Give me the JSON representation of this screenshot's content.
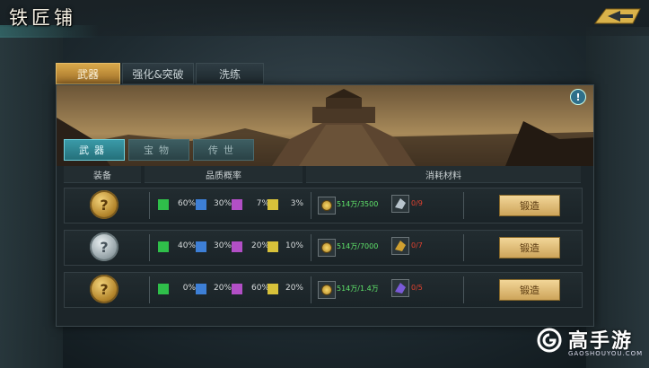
{
  "window": {
    "title": "铁匠铺"
  },
  "main_tabs": [
    {
      "label": "武器",
      "active": true
    },
    {
      "label": "强化&突破",
      "active": false
    },
    {
      "label": "洗练",
      "active": false
    }
  ],
  "sub_tabs": [
    {
      "label": "武器",
      "active": true
    },
    {
      "label": "宝物",
      "active": false
    },
    {
      "label": "传世",
      "active": false
    }
  ],
  "info_icon": {
    "glyph": "!"
  },
  "table": {
    "headers": [
      "装备",
      "品质概率",
      "消耗材料"
    ],
    "rows": [
      {
        "equip_icon": "mystery-gold-coin-icon",
        "equip_glyph": "?",
        "probabilities": [
          "60%",
          "30%",
          "7%",
          "3%"
        ],
        "coin_cost": "514万/3500",
        "material_icon": "silver-ore-icon",
        "material_count": "0/9",
        "button": "锻造"
      },
      {
        "equip_icon": "mystery-silver-coin-icon",
        "equip_glyph": "?",
        "probabilities": [
          "40%",
          "30%",
          "20%",
          "10%"
        ],
        "coin_cost": "514万/7000",
        "material_icon": "gold-ore-icon",
        "material_count": "0/7",
        "button": "锻造"
      },
      {
        "equip_icon": "mystery-gold-coin-icon",
        "equip_glyph": "?",
        "probabilities": [
          "0%",
          "20%",
          "60%",
          "20%"
        ],
        "coin_cost": "514万/1.4万",
        "material_icon": "purple-ore-icon",
        "material_count": "0/5",
        "button": "锻造"
      }
    ]
  },
  "quality_colors": [
    "#2fbf4a",
    "#3d7fd6",
    "#b24fc6",
    "#d8c23a"
  ],
  "watermark": {
    "brand": "高手游",
    "url": "GAOSHOUYOU.COM"
  }
}
